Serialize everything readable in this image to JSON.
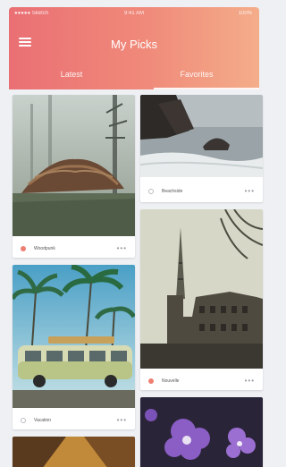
{
  "status_bar": {
    "carrier": "●●●●● Sketch",
    "time": "9:41 AM",
    "battery": "100%"
  },
  "header": {
    "title": "My Picks"
  },
  "tabs": [
    {
      "label": "Latest"
    },
    {
      "label": "Favorites"
    }
  ],
  "cards": [
    {
      "label": "Woodpunk",
      "more": "•••"
    },
    {
      "label": "Beachside",
      "more": "•••"
    },
    {
      "label": "Vacation",
      "more": "•••"
    },
    {
      "label": "Nouvelle",
      "more": "•••"
    }
  ],
  "colors": {
    "header_start": "#ea6f74",
    "header_end": "#f4ad8a",
    "accent": "#ef7e72"
  }
}
